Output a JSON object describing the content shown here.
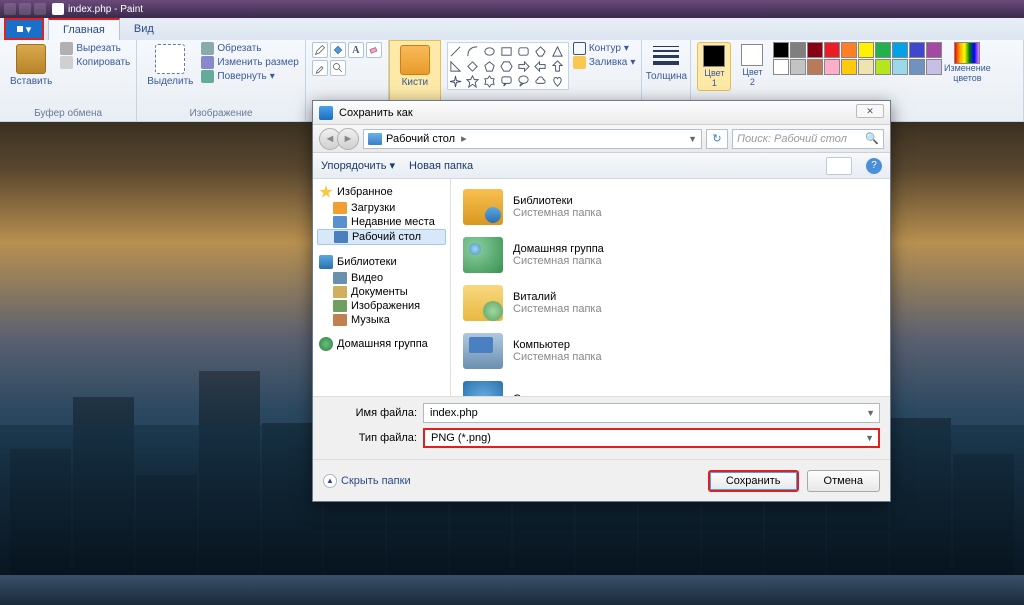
{
  "window": {
    "title": "index.php - Paint"
  },
  "tabs": {
    "home": "Главная",
    "view": "Вид"
  },
  "ribbon": {
    "clipboard": {
      "label": "Буфер обмена",
      "paste": "Вставить",
      "cut": "Вырезать",
      "copy": "Копировать"
    },
    "image": {
      "label": "Изображение",
      "select": "Выделить",
      "crop": "Обрезать",
      "resize": "Изменить размер",
      "rotate": "Повернуть"
    },
    "brushes": {
      "label": "Кисти"
    },
    "shapes_opts": {
      "outline": "Контур",
      "fill": "Заливка"
    },
    "thickness": "Толщина",
    "color1": "Цвет\n1",
    "color2": "Цвет\n2",
    "edit_colors": "Изменение\nцветов",
    "palette": [
      "#000000",
      "#7f7f7f",
      "#880015",
      "#ed1c24",
      "#ff7f27",
      "#fff200",
      "#22b14c",
      "#00a2e8",
      "#3f48cc",
      "#a349a4",
      "#ffffff",
      "#c3c3c3",
      "#b97a57",
      "#ffaec9",
      "#ffc90e",
      "#efe4b0",
      "#b5e61d",
      "#99d9ea",
      "#7092be",
      "#c8bfe7"
    ]
  },
  "dialog": {
    "title": "Сохранить как",
    "breadcrumb": "Рабочий стол",
    "search_placeholder": "Поиск: Рабочий стол",
    "organize": "Упорядочить",
    "new_folder": "Новая папка",
    "favorites": {
      "header": "Избранное",
      "items": [
        "Загрузки",
        "Недавние места",
        "Рабочий стол"
      ]
    },
    "libraries": {
      "header": "Библиотеки",
      "items": [
        "Видео",
        "Документы",
        "Изображения",
        "Музыка"
      ]
    },
    "homegroup": "Домашняя группа",
    "content": [
      {
        "name": "Библиотеки",
        "sub": "Системная папка"
      },
      {
        "name": "Домашняя группа",
        "sub": "Системная папка"
      },
      {
        "name": "Виталий",
        "sub": "Системная папка"
      },
      {
        "name": "Компьютер",
        "sub": "Системная папка"
      },
      {
        "name": "Сеть",
        "sub": ""
      }
    ],
    "filename_label": "Имя файла:",
    "filetype_label": "Тип файла:",
    "filename": "index.php",
    "filetype": "PNG (*.png)",
    "hide_folders": "Скрыть папки",
    "save": "Сохранить",
    "cancel": "Отмена"
  }
}
